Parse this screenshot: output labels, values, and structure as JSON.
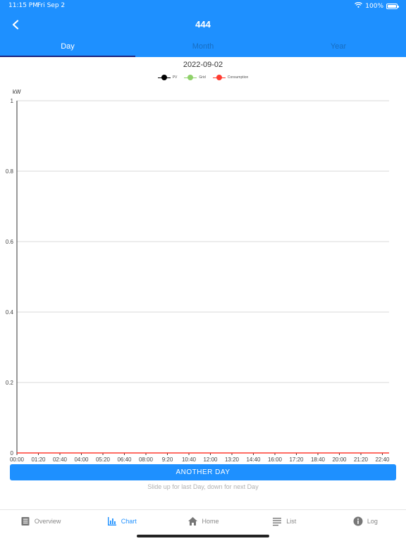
{
  "status_bar": {
    "time": "11:15 PM",
    "date": "Fri Sep 2",
    "battery": "100%"
  },
  "header": {
    "title": "444"
  },
  "tabs": [
    {
      "label": "Day",
      "active": true
    },
    {
      "label": "Month",
      "active": false
    },
    {
      "label": "Year",
      "active": false
    }
  ],
  "date_label": "2022-09-02",
  "chart_data": {
    "type": "line",
    "ylabel": "kW",
    "ylim": [
      0,
      1
    ],
    "yticks": [
      "0",
      "0.2",
      "0.4",
      "0.6",
      "0.8",
      "1"
    ],
    "xticks": [
      "00:00",
      "01:20",
      "02:40",
      "04:00",
      "05:20",
      "06:40",
      "08:00",
      "9:20",
      "10:40",
      "12:00",
      "13:20",
      "14:40",
      "16:00",
      "17:20",
      "18:40",
      "20:00",
      "21:20",
      "22:40"
    ],
    "grid": true,
    "legend_position": "top-center",
    "series": [
      {
        "name": "PV",
        "color": "#000000",
        "values": []
      },
      {
        "name": "Grid",
        "color": "#8fd16a",
        "values": []
      },
      {
        "name": "Consumption",
        "color": "#ff3b30",
        "values": [
          0,
          0,
          0,
          0,
          0,
          0,
          0,
          0,
          0,
          0,
          0,
          0,
          0,
          0,
          0,
          0,
          0,
          0
        ]
      }
    ]
  },
  "actions": {
    "another_day": "ANOTHER DAY",
    "hint": "Slide up for last Day, down for next Day"
  },
  "bottom_nav": [
    {
      "label": "Overview",
      "icon": "book-icon",
      "active": false
    },
    {
      "label": "Chart",
      "icon": "bar-chart-icon",
      "active": true
    },
    {
      "label": "Home",
      "icon": "home-icon",
      "active": false
    },
    {
      "label": "List",
      "icon": "list-icon",
      "active": false
    },
    {
      "label": "Log",
      "icon": "info-icon",
      "active": false
    }
  ],
  "colors": {
    "primary": "#1e90ff",
    "tab_indicator": "#1a237e"
  }
}
